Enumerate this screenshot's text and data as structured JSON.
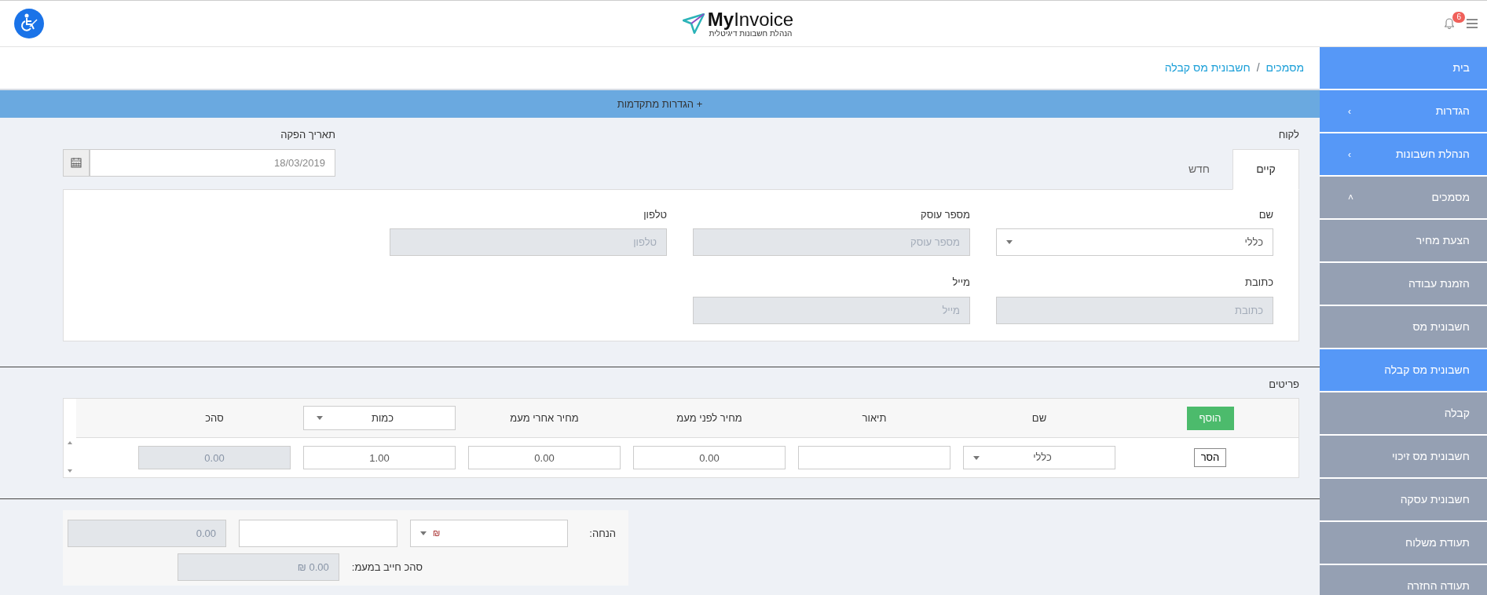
{
  "header": {
    "logo": {
      "name_bold": "My",
      "name_rest": "Invoice",
      "tagline": "הנהלת חשבונות דיגיטלית"
    },
    "notifications": {
      "count": "6"
    }
  },
  "sidebar": {
    "items": [
      {
        "label": "בית",
        "selected": false
      },
      {
        "label": "הגדרות",
        "selected": false,
        "expanded": false,
        "chevron": "›"
      },
      {
        "label": "הנהלת חשבונות",
        "selected": false,
        "expanded": false,
        "chevron": "›"
      },
      {
        "label": "מסמכים",
        "selected": false,
        "expanded": true,
        "chevron": "˄",
        "children": [
          {
            "label": "הצעת מחיר",
            "selected": false
          },
          {
            "label": "הזמנת עבודה",
            "selected": false
          },
          {
            "label": "חשבונית מס",
            "selected": false
          },
          {
            "label": "חשבונית מס קבלה",
            "selected": true
          },
          {
            "label": "קבלה",
            "selected": false
          },
          {
            "label": "חשבונית מס זיכוי",
            "selected": false
          },
          {
            "label": "חשבונית עסקה",
            "selected": false
          },
          {
            "label": "תעודת משלוח",
            "selected": false
          },
          {
            "label": "תעודה החזרה",
            "selected": false
          }
        ]
      }
    ]
  },
  "breadcrumb": {
    "items": [
      "מסמכים",
      "חשבונית מס קבלה"
    ],
    "separator": "/"
  },
  "advanced_bar": {
    "label": "+ הגדרות מתקדמות"
  },
  "customer": {
    "label": "לקוח",
    "tabs": [
      {
        "label": "קיים",
        "selected": true
      },
      {
        "label": "חדש",
        "selected": false
      }
    ],
    "fields": [
      {
        "label": "שם",
        "kind": "select",
        "value": "כללי"
      },
      {
        "label": "מספר עוסק",
        "kind": "readonly",
        "placeholder": "מספר עוסק"
      },
      {
        "label": "טלפון",
        "kind": "readonly",
        "placeholder": "טלפון"
      },
      {
        "label": "כתובת",
        "kind": "readonly",
        "placeholder": "כתובת"
      },
      {
        "label": "מייל",
        "kind": "readonly",
        "placeholder": "מייל"
      }
    ]
  },
  "issue_date": {
    "label": "תאריך הפקה",
    "value": "18/03/2019"
  },
  "items_table": {
    "label": "פריטים",
    "add_button": "הוסף",
    "columns": [
      "שם",
      "תיאור",
      "מחיר לפני מעמ",
      "מחיר אחרי מעמ"
    ],
    "quantity_select": "כמות",
    "total_column": "סהכ",
    "rows": [
      {
        "remove_button": "הסר",
        "name": "כללי",
        "description": "",
        "price_before": "0.00",
        "price_after": "0.00",
        "quantity": "1.00",
        "total": "0.00"
      }
    ]
  },
  "summary": {
    "discount_label": "הנחה:",
    "discount_currency": "₪",
    "discount_total": "0.00",
    "vat_label": "סהכ חייב במעמ:",
    "vat_total": "0.00 ₪"
  }
}
